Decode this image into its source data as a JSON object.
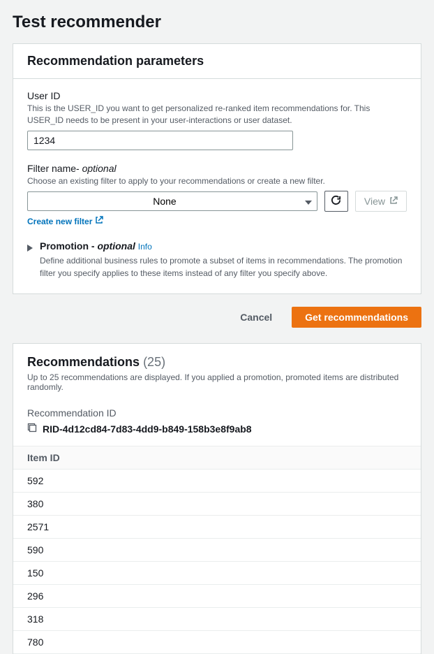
{
  "page_title": "Test recommender",
  "params_panel": {
    "title": "Recommendation parameters",
    "user_id": {
      "label": "User ID",
      "desc": "This is the USER_ID you want to get personalized re-ranked item recommendations for. This USER_ID needs to be present in your user-interactions or user dataset.",
      "value": "1234"
    },
    "filter": {
      "label_prefix": "Filter name- ",
      "label_optional": "optional",
      "desc": "Choose an existing filter to apply to your recommendations or create a new filter.",
      "selected": "None",
      "view_label": "View",
      "create_link": "Create new filter"
    },
    "promotion": {
      "title_prefix": "Promotion - ",
      "title_optional": "optional",
      "info": "Info",
      "desc": "Define additional business rules to promote a subset of items in recommendations. The promotion filter you specify applies to these items instead of any filter you specify above."
    }
  },
  "actions": {
    "cancel": "Cancel",
    "primary": "Get recommendations"
  },
  "recommendations": {
    "title": "Recommendations",
    "count_display": "(25)",
    "subtitle": "Up to 25 recommendations are displayed. If you applied a promotion, promoted items are distributed randomly.",
    "rec_id_label": "Recommendation ID",
    "rec_id_value": "RID-4d12cd84-7d83-4dd9-b849-158b3e8f9ab8",
    "column_header": "Item ID",
    "items": [
      "592",
      "380",
      "2571",
      "590",
      "150",
      "296",
      "318",
      "780"
    ]
  }
}
